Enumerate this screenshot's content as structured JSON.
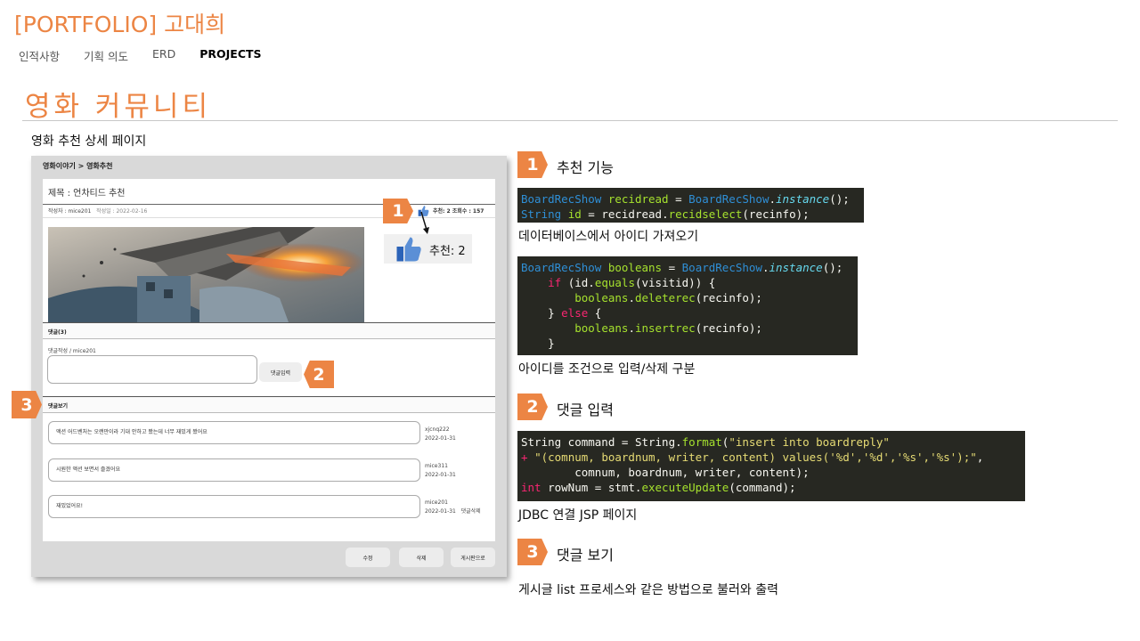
{
  "header": {
    "title": "[PORTFOLIO] 고대희",
    "nav": [
      "인적사항",
      "기획 의도",
      "ERD",
      "PROJECTS"
    ],
    "active_nav": "PROJECTS"
  },
  "section": {
    "title": "영화 커뮤니티",
    "subtitle": "영화 추천 상세 페이지"
  },
  "mockup": {
    "breadcrumb": "영화이야기 > 영화추천",
    "post_title": "제목 : 언차티드 추천",
    "author_label": "작성자 : mice201",
    "date_label": "작성일 : 2022-02-16",
    "stats": "추천: 2   조회수 : 157",
    "recommend_text": "추천: 2",
    "comments_bar": "댓글(3)",
    "reply_label": "댓글작성 / mice201",
    "reply_button": "댓글입력",
    "view_bar": "댓글보기",
    "comments": [
      {
        "text": "액션 어드벤처는 오랜만이라 기대 안하고 봤는데 너무 재밌게 봤어요",
        "user": "xjcnq222",
        "date": "2022-01-31",
        "extra": ""
      },
      {
        "text": "시원한 액션 보면서 즐겼어요",
        "user": "mice311",
        "date": "2022-01-31",
        "extra": ""
      },
      {
        "text": "재밌었어요!",
        "user": "mice201",
        "date": "2022-01-31",
        "extra": "댓글삭제"
      }
    ],
    "buttons": [
      "수정",
      "삭제",
      "게시판으로"
    ]
  },
  "tags": [
    "1",
    "2",
    "3"
  ],
  "features": [
    {
      "num": "1",
      "title": "추천 기능"
    },
    {
      "num": "2",
      "title": "댓글 입력"
    },
    {
      "num": "3",
      "title": "댓글 보기"
    }
  ],
  "descriptions": {
    "d1": "데이터베이스에서 아이디 가져오기",
    "d2": "아이디를 조건으로 입력/삭제 구분",
    "d3": "JDBC 연결 JSP 페이지",
    "d4": "게시글 list 프로세스와 같은 방법으로 불러와 출력"
  },
  "colors": {
    "accent": "#ec8544",
    "code_bg": "#272822"
  }
}
